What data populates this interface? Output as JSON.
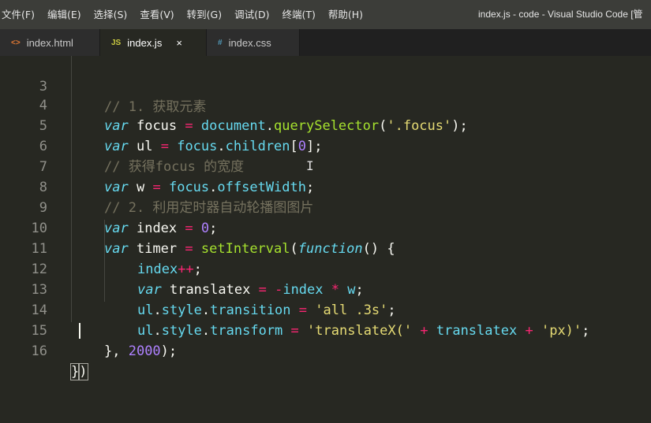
{
  "menu": [
    "文件(F)",
    "编辑(E)",
    "选择(S)",
    "查看(V)",
    "转到(G)",
    "调试(D)",
    "终端(T)",
    "帮助(H)"
  ],
  "window_title": "index.js - code - Visual Studio Code [管",
  "tabs": [
    {
      "icon_text": "<>",
      "label": "index.html",
      "active": false
    },
    {
      "icon_text": "JS",
      "label": "index.js",
      "active": true,
      "close": "×"
    },
    {
      "icon_text": "#",
      "label": "index.css",
      "active": false
    }
  ],
  "colors": {
    "html_icon": "#e37933",
    "js_icon": "#cbcb41",
    "css_icon": "#519aba",
    "editor_bg": "#272822"
  },
  "code": {
    "l3": {
      "num": "3",
      "comment": "// 1. 获取元素"
    },
    "l4": {
      "num": "4",
      "kw": "var",
      "name": "focus",
      "eq": "=",
      "obj": "document",
      "dot": ".",
      "method": "querySelector",
      "open": "(",
      "str": "'.focus'",
      "close": ");"
    },
    "l5": {
      "num": "5",
      "kw": "var",
      "name": "ul",
      "eq": "=",
      "obj": "focus",
      "dot": ".",
      "prop": "children",
      "open": "[",
      "idx": "0",
      "close": "];"
    },
    "l6": {
      "num": "6",
      "comment": "// 获得focus 的宽度"
    },
    "l7": {
      "num": "7",
      "kw": "var",
      "name": "w",
      "eq": "=",
      "obj": "focus",
      "dot": ".",
      "prop": "offsetWidth",
      "close": ";"
    },
    "l8": {
      "num": "8",
      "comment": "// 2. 利用定时器自动轮播图图片"
    },
    "l9": {
      "num": "9",
      "kw": "var",
      "name": "index",
      "eq": "=",
      "val": "0",
      "close": ";"
    },
    "l10": {
      "num": "10",
      "kw": "var",
      "name": "timer",
      "eq": "=",
      "fn": "setInterval",
      "open": "(",
      "kw2": "function",
      "rest": "() {"
    },
    "l11": {
      "num": "11",
      "name": "index",
      "op": "++",
      "close": ";"
    },
    "l12": {
      "num": "12",
      "kw": "var",
      "name": "translatex",
      "eq": "=",
      "neg": "-",
      "a": "index",
      "mul": "*",
      "b": "w",
      "close": ";"
    },
    "l13": {
      "num": "13",
      "obj": "ul",
      "d1": ".",
      "p1": "style",
      "d2": ".",
      "p2": "transition",
      "eq": "=",
      "str": "'all .3s'",
      "close": ";"
    },
    "l14": {
      "num": "14",
      "obj": "ul",
      "d1": ".",
      "p1": "style",
      "d2": ".",
      "p2": "transform",
      "eq": "=",
      "s1": "'translateX('",
      "plus1": "+",
      "mid": "translatex",
      "plus2": "+",
      "s2": "'px)'",
      "close": ";"
    },
    "l15": {
      "num": "15",
      "open": "}, ",
      "val": "2000",
      "close": ");"
    },
    "l16": {
      "num": "16",
      "b1": "}",
      "b2": ")"
    }
  }
}
